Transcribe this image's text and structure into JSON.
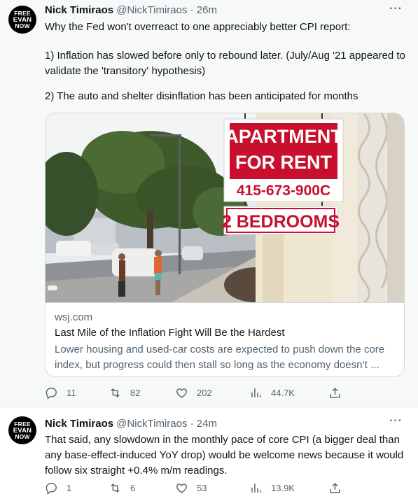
{
  "tweets": [
    {
      "avatar": {
        "line1": "FREE",
        "line2": "EVAN",
        "line3": "NOW"
      },
      "display_name": "Nick Timiraos",
      "handle_time": "@NickTimiraos · 26m",
      "more": "···",
      "paragraphs": [
        "Why the Fed won't overreact to one appreciably better CPI report:",
        "1) Inflation has slowed before only to rebound later. (July/Aug '21 appeared to validate the 'transitory' hypothesis)",
        "2) The auto and shelter disinflation has been anticipated for months"
      ],
      "card": {
        "domain": "wsj.com",
        "title": "Last Mile of the Inflation Fight Will Be the Hardest",
        "description": "Lower housing and used-car costs are expected to push down the core index, but progress could then stall so long as the economy doesn’t ...",
        "sign": {
          "line1": "APARTMENT",
          "line2": "FOR RENT",
          "phone": "415-673-900C",
          "rooms": "2 BEDROOMS"
        }
      },
      "actions": {
        "replies": "11",
        "retweets": "82",
        "likes": "202",
        "views": "44.7K"
      }
    },
    {
      "avatar": {
        "line1": "FREE",
        "line2": "EVAN",
        "line3": "NOW"
      },
      "display_name": "Nick Timiraos",
      "handle_time": "@NickTimiraos · 24m",
      "more": "···",
      "text": "That said, any slowdown in the monthly pace of core CPI (a bigger deal than any base-effect-induced YoY drop) would be welcome news because it would follow six straight +0.4% m/m readings.",
      "actions": {
        "replies": "1",
        "retweets": "6",
        "likes": "53",
        "views": "13.9K"
      }
    }
  ],
  "colors": {
    "text": "#0f1419",
    "secondary": "#536471",
    "border": "#cfd9de",
    "highlight_bg": "#f7f9f9",
    "sign_red": "#c8102e"
  },
  "icons": [
    "reply-icon",
    "retweet-icon",
    "like-icon",
    "views-icon",
    "share-icon",
    "more-icon"
  ]
}
